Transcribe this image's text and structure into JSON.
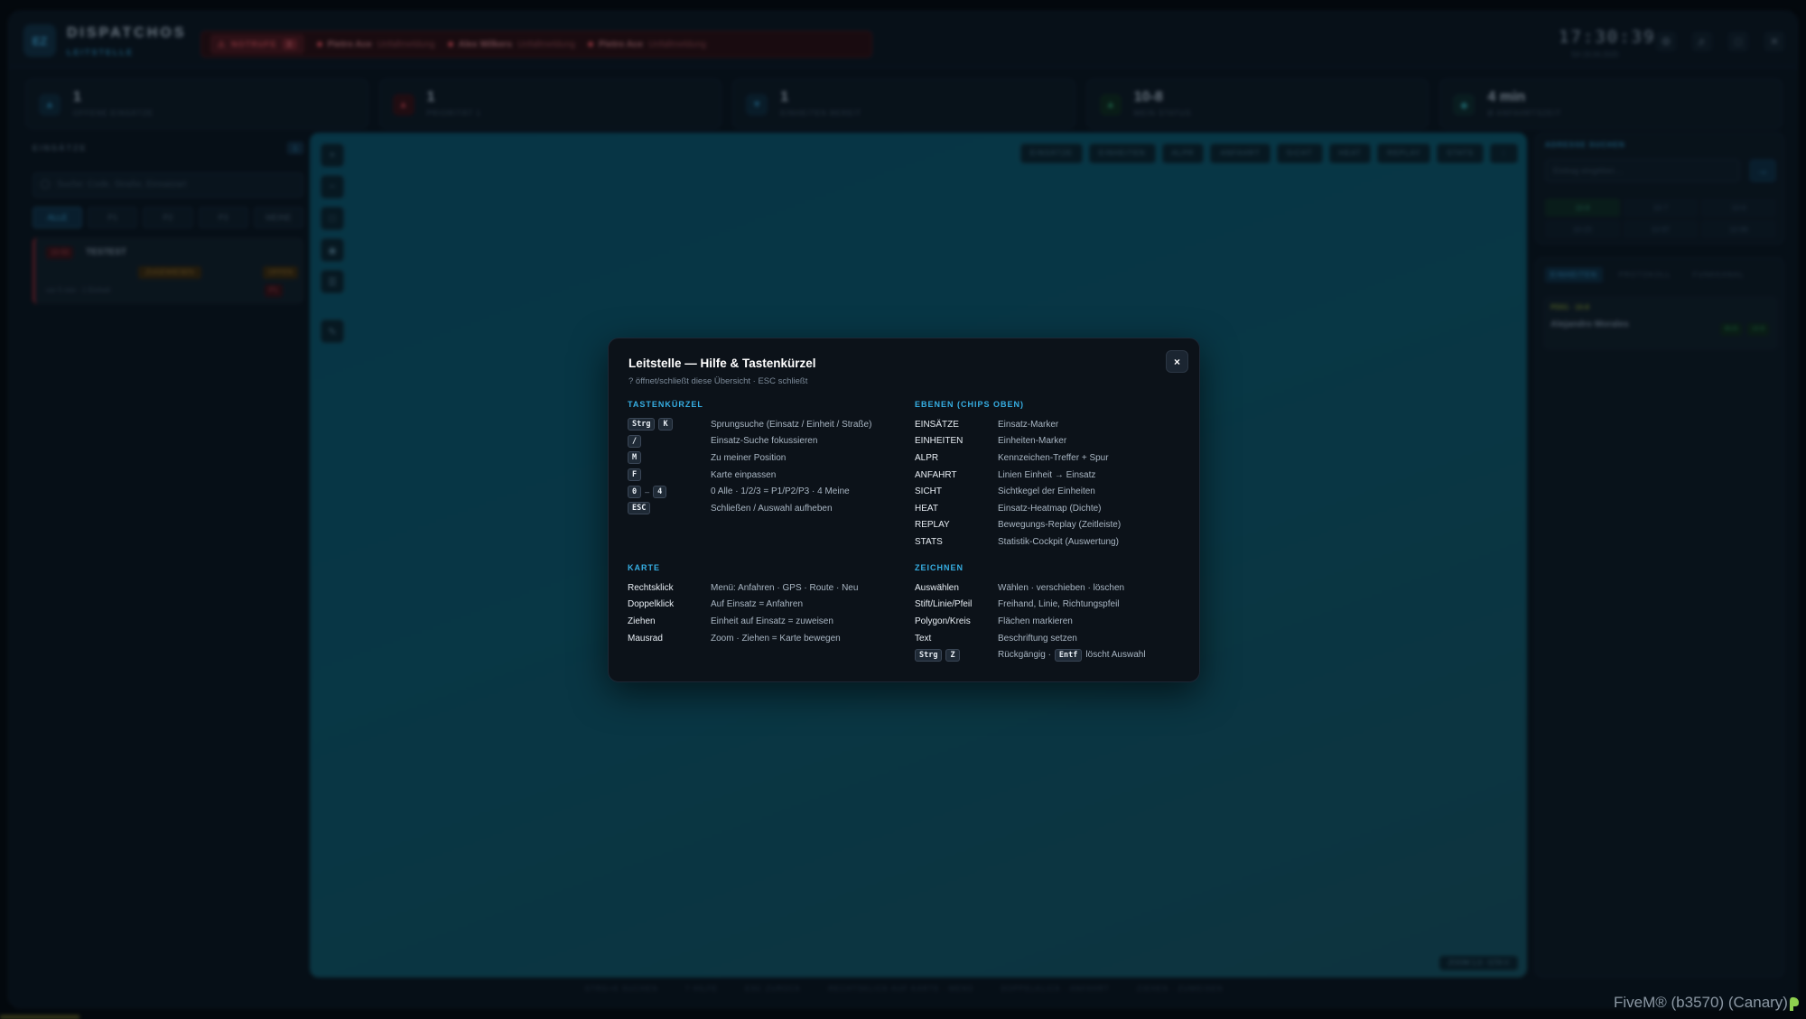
{
  "app": {
    "logo": "EZ",
    "brand": "DISPATCHOS",
    "brand_sub": "LEITSTELLE",
    "clock": "17:30:39",
    "clock_sub": "SA 19.04.2025",
    "alerts": {
      "label": "NOTRUFE",
      "count": "3",
      "items": [
        {
          "name": "Pietro Ace",
          "text": "Unfallmeldung"
        },
        {
          "name": "Alex Wilkers",
          "text": "Unfallmeldung"
        },
        {
          "name": "Pietro Ace",
          "text": "Unfallmeldung"
        }
      ]
    },
    "stats": [
      {
        "value": "1",
        "label": "OFFENE EINSÄTZE",
        "icon": "incident-icon",
        "color": "#2f8fbe"
      },
      {
        "value": "1",
        "label": "PRIORITÄT 1",
        "icon": "alert-icon",
        "color": "#c0404d"
      },
      {
        "value": "1",
        "label": "EINHEITEN BEREIT",
        "icon": "shield-icon",
        "color": "#2f8fbe"
      },
      {
        "value": "10-8",
        "label": "MEIN STATUS",
        "icon": "status-icon",
        "color": "#2f9f6e"
      },
      {
        "value": "4 min",
        "label": "Ø ANFAHRTSZEIT",
        "icon": "timer-icon",
        "color": "#2f9fa8"
      }
    ],
    "sidebar": {
      "title": "EINSÄTZE",
      "count": "1",
      "search_placeholder": "Suche: Code, Straße, Einsatzart",
      "filters": [
        "ALLE",
        "P1",
        "P2",
        "P3",
        "MEINE"
      ],
      "incident": {
        "tag": "10-50",
        "title": "TESTEST",
        "state": "ZUGEWIESEN",
        "state2": "OFFEN",
        "meta": "vor 5 min · 1 Einheit",
        "prio": "P1"
      }
    },
    "map": {
      "layers": [
        "EINSÄTZE",
        "EINHEITEN",
        "ALPR",
        "ANFAHRT",
        "SICHT",
        "HEAT",
        "REPLAY",
        "STATS"
      ],
      "footer": "ZOOM 1.0 · GTA V"
    },
    "right": {
      "search_title": "ADRESSE SUCHEN",
      "search_placeholder": "Eintrag eingeben…",
      "grid": [
        "10-8",
        "10-7",
        "10-6",
        "10-23",
        "10-97",
        "10-99"
      ],
      "tabs": [
        "EINHEITEN",
        "PROTOKOLL",
        "FUNKKANAL"
      ],
      "unit": {
        "tag": "PD01 · 10-8",
        "name": "Alejandro Morales",
        "s1": "BUS",
        "s2": "10-8"
      }
    },
    "footer_hints": [
      "STRG+K SUCHEN",
      "? HILFE",
      "ESC ZURÜCK",
      "RECHTSKLICK AUF KARTE · MENÜ",
      "DOPPELKLICK · ANFAHRT",
      "ZIEHEN · ZUWEISEN"
    ]
  },
  "modal": {
    "title": "Leitstelle — Hilfe & Tastenkürzel",
    "subtitle": "? öffnet/schließt diese Übersicht · ESC schließt",
    "close_label": "×",
    "shortcuts": {
      "heading": "TASTENKÜRZEL",
      "rows": [
        {
          "keys": [
            "Strg",
            "K"
          ],
          "sep": "",
          "desc": "Sprungsuche (Einsatz / Einheit / Straße)"
        },
        {
          "keys": [
            "/"
          ],
          "sep": "",
          "desc": "Einsatz-Suche fokussieren"
        },
        {
          "keys": [
            "M"
          ],
          "sep": "",
          "desc": "Zu meiner Position"
        },
        {
          "keys": [
            "F"
          ],
          "sep": "",
          "desc": "Karte einpassen"
        },
        {
          "keys": [
            "0",
            "4"
          ],
          "sep": "–",
          "desc": "0 Alle · 1/2/3 = P1/P2/P3 · 4 Meine"
        },
        {
          "keys": [
            "ESC"
          ],
          "sep": "",
          "desc": "Schließen / Auswahl aufheben"
        }
      ]
    },
    "layers": {
      "heading": "EBENEN (CHIPS OBEN)",
      "rows": [
        {
          "key": "EINSÄTZE",
          "desc": "Einsatz-Marker"
        },
        {
          "key": "EINHEITEN",
          "desc": "Einheiten-Marker"
        },
        {
          "key": "ALPR",
          "desc": "Kennzeichen-Treffer + Spur"
        },
        {
          "key": "ANFAHRT",
          "desc": "Linien Einheit → Einsatz"
        },
        {
          "key": "SICHT",
          "desc": "Sichtkegel der Einheiten"
        },
        {
          "key": "HEAT",
          "desc": "Einsatz-Heatmap (Dichte)"
        },
        {
          "key": "REPLAY",
          "desc": "Bewegungs-Replay (Zeitleiste)"
        },
        {
          "key": "STATS",
          "desc": "Statistik-Cockpit (Auswertung)"
        }
      ]
    },
    "karte": {
      "heading": "KARTE",
      "rows": [
        {
          "key": "Rechtsklick",
          "desc": "Menü: Anfahren · GPS · Route · Neu"
        },
        {
          "key": "Doppelklick",
          "desc": "Auf Einsatz = Anfahren"
        },
        {
          "key": "Ziehen",
          "desc": "Einheit auf Einsatz = zuweisen"
        },
        {
          "key": "Mausrad",
          "desc": "Zoom · Ziehen = Karte bewegen"
        }
      ]
    },
    "zeichnen": {
      "heading": "ZEICHNEN",
      "rows": [
        {
          "key": "Auswählen",
          "desc": "Wählen · verschieben · löschen"
        },
        {
          "key": "Stift/Linie/Pfeil",
          "desc": "Freihand, Linie, Richtungspfeil"
        },
        {
          "key": "Polygon/Kreis",
          "desc": "Flächen markieren"
        },
        {
          "key": "Text",
          "desc": "Beschriftung setzen"
        }
      ],
      "undo": {
        "keys": [
          "Strg",
          "Z"
        ],
        "desc_a": "Rückgängig ·",
        "desc_key": "Entf",
        "desc_b": "löscht Auswahl"
      }
    }
  },
  "overlay": {
    "fivem": "FiveM® (b3570) (Canary)"
  }
}
